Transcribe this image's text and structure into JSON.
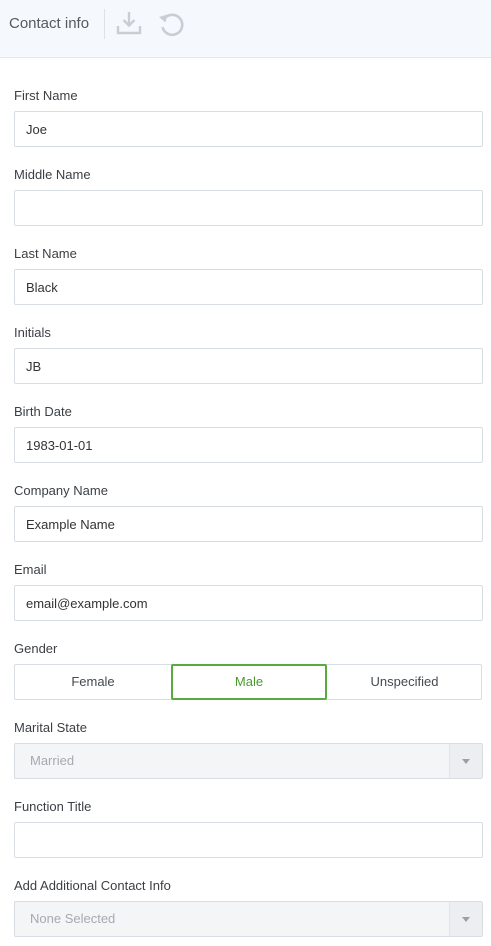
{
  "header": {
    "title": "Contact info",
    "icons": [
      "download-icon",
      "undo-icon"
    ]
  },
  "form": {
    "first_name": {
      "label": "First Name",
      "value": "Joe",
      "placeholder": ""
    },
    "middle_name": {
      "label": "Middle Name",
      "value": "",
      "placeholder": ""
    },
    "last_name": {
      "label": "Last Name",
      "value": "Black",
      "placeholder": ""
    },
    "initials": {
      "label": "Initials",
      "value": "JB",
      "placeholder": ""
    },
    "birth_date": {
      "label": "Birth Date",
      "value": "1983-01-01",
      "placeholder": ""
    },
    "company_name": {
      "label": "Company Name",
      "value": "Example Name",
      "placeholder": ""
    },
    "email": {
      "label": "Email",
      "value": "email@example.com",
      "placeholder": ""
    },
    "gender": {
      "label": "Gender",
      "options": [
        "Female",
        "Male",
        "Unspecified"
      ],
      "selected": "Male"
    },
    "marital_state": {
      "label": "Marital State",
      "selected": "Married"
    },
    "function_title": {
      "label": "Function Title",
      "value": "",
      "placeholder": ""
    },
    "additional_contact_info": {
      "label": "Add Additional Contact Info",
      "selected": "None Selected"
    }
  },
  "colors": {
    "accent": "#5aab3f",
    "header_bg": "#f5f9fd",
    "border": "#d8dde3"
  }
}
